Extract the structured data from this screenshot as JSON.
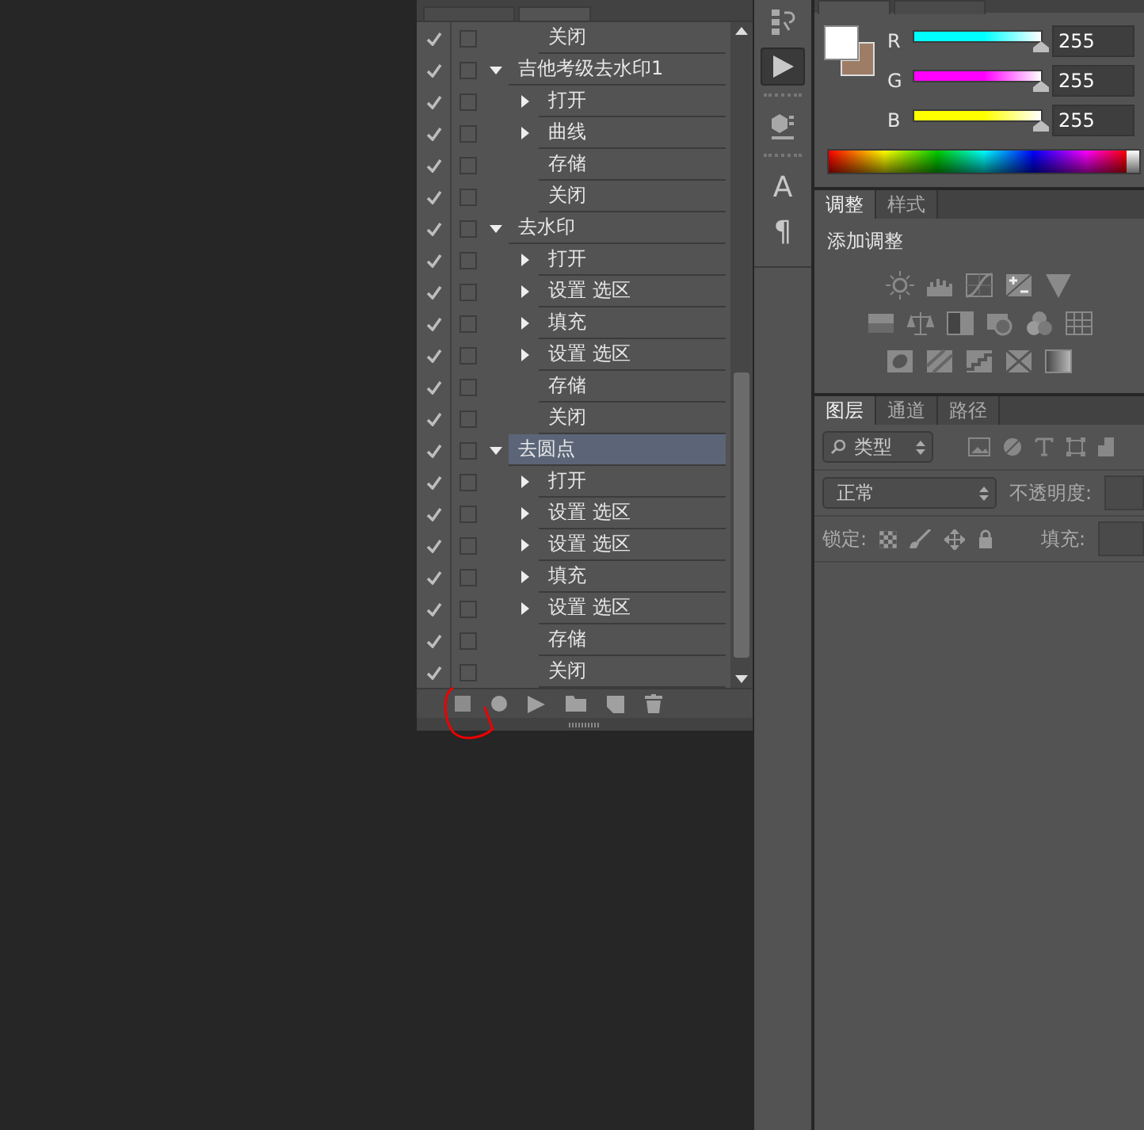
{
  "actions_panel": {
    "rows": [
      {
        "kind": "step",
        "label": "关闭",
        "enabled": true,
        "dialog": false,
        "expandable": false
      },
      {
        "kind": "action",
        "label": "吉他考级去水印1",
        "enabled": true,
        "dialog": false,
        "expanded": true,
        "selected": false,
        "children": [
          {
            "kind": "step",
            "label": "打开",
            "enabled": true,
            "dialog": false,
            "expandable": true
          },
          {
            "kind": "step",
            "label": "曲线",
            "enabled": true,
            "dialog": false,
            "expandable": true
          },
          {
            "kind": "step",
            "label": "存储",
            "enabled": true,
            "dialog": false,
            "expandable": false
          },
          {
            "kind": "step",
            "label": "关闭",
            "enabled": true,
            "dialog": false,
            "expandable": false
          }
        ]
      },
      {
        "kind": "action",
        "label": "去水印",
        "enabled": true,
        "dialog": false,
        "expanded": true,
        "selected": false,
        "children": [
          {
            "kind": "step",
            "label": "打开",
            "enabled": true,
            "dialog": false,
            "expandable": true
          },
          {
            "kind": "step",
            "label": "设置 选区",
            "enabled": true,
            "dialog": false,
            "expandable": true
          },
          {
            "kind": "step",
            "label": "填充",
            "enabled": true,
            "dialog": false,
            "expandable": true
          },
          {
            "kind": "step",
            "label": "设置 选区",
            "enabled": true,
            "dialog": false,
            "expandable": true
          },
          {
            "kind": "step",
            "label": "存储",
            "enabled": true,
            "dialog": false,
            "expandable": false
          },
          {
            "kind": "step",
            "label": "关闭",
            "enabled": true,
            "dialog": false,
            "expandable": false
          }
        ]
      },
      {
        "kind": "action",
        "label": "去圆点",
        "enabled": true,
        "dialog": false,
        "expanded": true,
        "selected": true,
        "children": [
          {
            "kind": "step",
            "label": "打开",
            "enabled": true,
            "dialog": false,
            "expandable": true
          },
          {
            "kind": "step",
            "label": "设置 选区",
            "enabled": true,
            "dialog": false,
            "expandable": true
          },
          {
            "kind": "step",
            "label": "设置 选区",
            "enabled": true,
            "dialog": false,
            "expandable": true
          },
          {
            "kind": "step",
            "label": "填充",
            "enabled": true,
            "dialog": false,
            "expandable": true
          },
          {
            "kind": "step",
            "label": "设置 选区",
            "enabled": true,
            "dialog": false,
            "expandable": true
          },
          {
            "kind": "step",
            "label": "存储",
            "enabled": true,
            "dialog": false,
            "expandable": false
          },
          {
            "kind": "step",
            "label": "关闭",
            "enabled": true,
            "dialog": false,
            "expandable": false
          }
        ]
      }
    ]
  },
  "tool_strip": {
    "buttons": [
      {
        "kind": "history",
        "selected": false
      },
      {
        "kind": "play",
        "selected": true
      },
      {
        "kind": "cube",
        "selected": false
      },
      {
        "kind": "glyph",
        "glyph": "A",
        "selected": false
      },
      {
        "kind": "glyph",
        "glyph": "¶",
        "selected": false
      }
    ]
  },
  "color_panel": {
    "swatches": [
      {
        "kind": "foreground",
        "color": "#ffffff"
      },
      {
        "kind": "background",
        "color": "#9e7d66"
      }
    ],
    "sliders": [
      {
        "label": "R",
        "level": 1,
        "value": "255",
        "color": "#00ffff"
      },
      {
        "label": "G",
        "level": 1,
        "value": "255",
        "color": "#ff00ff"
      },
      {
        "label": "B",
        "level": 1,
        "value": "255",
        "color": "#ffff00"
      }
    ]
  },
  "adjustments_panel": {
    "tabs": [
      {
        "label": "调整",
        "selected": true
      },
      {
        "label": "样式",
        "selected": false
      }
    ],
    "title": "添加调整"
  },
  "layers_panel": {
    "tabs": [
      {
        "label": "图层",
        "selected": true
      },
      {
        "label": "通道",
        "selected": false
      },
      {
        "label": "路径",
        "selected": false
      }
    ],
    "filter": {
      "value": "类型"
    },
    "blend_mode": {
      "value": "正常"
    },
    "opacity_label": "不透明度:",
    "lock_label": "锁定:",
    "fill_label": "填充:"
  }
}
